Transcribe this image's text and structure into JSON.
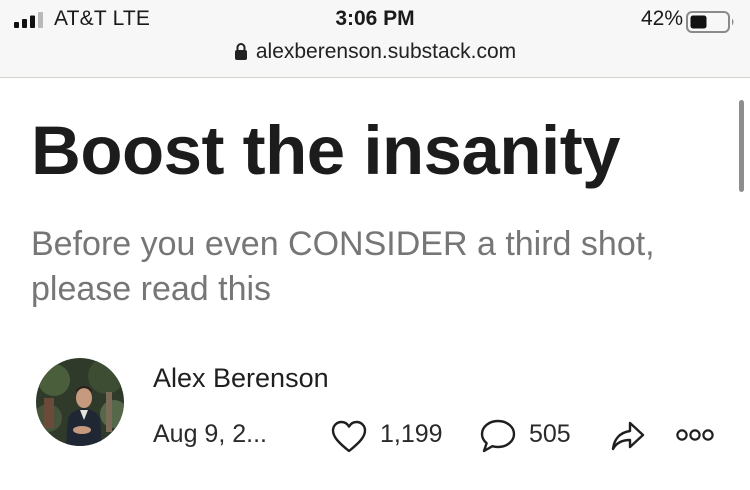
{
  "status_bar": {
    "carrier": "AT&T  LTE",
    "time": "3:06 PM",
    "battery": "42%",
    "signal_icon": "cellular-signal-icon",
    "battery_icon": "battery-icon"
  },
  "address_bar": {
    "url": "alexberenson.substack.com",
    "lock_icon": "lock-icon"
  },
  "article": {
    "title": "Boost the insanity",
    "subtitle": "Before you even CONSIDER a third shot, please read this",
    "author": "Alex Berenson",
    "date": "Aug 9, 2...",
    "likes": "1,199",
    "comments": "505",
    "icons": {
      "like": "heart-icon",
      "comment": "comment-bubble-icon",
      "share": "share-arrow-icon",
      "more": "more-options-icon"
    }
  },
  "colors": {
    "title": "#1c1c1c",
    "subtitle": "#767676",
    "topbar_bg": "#f7f7f7"
  }
}
